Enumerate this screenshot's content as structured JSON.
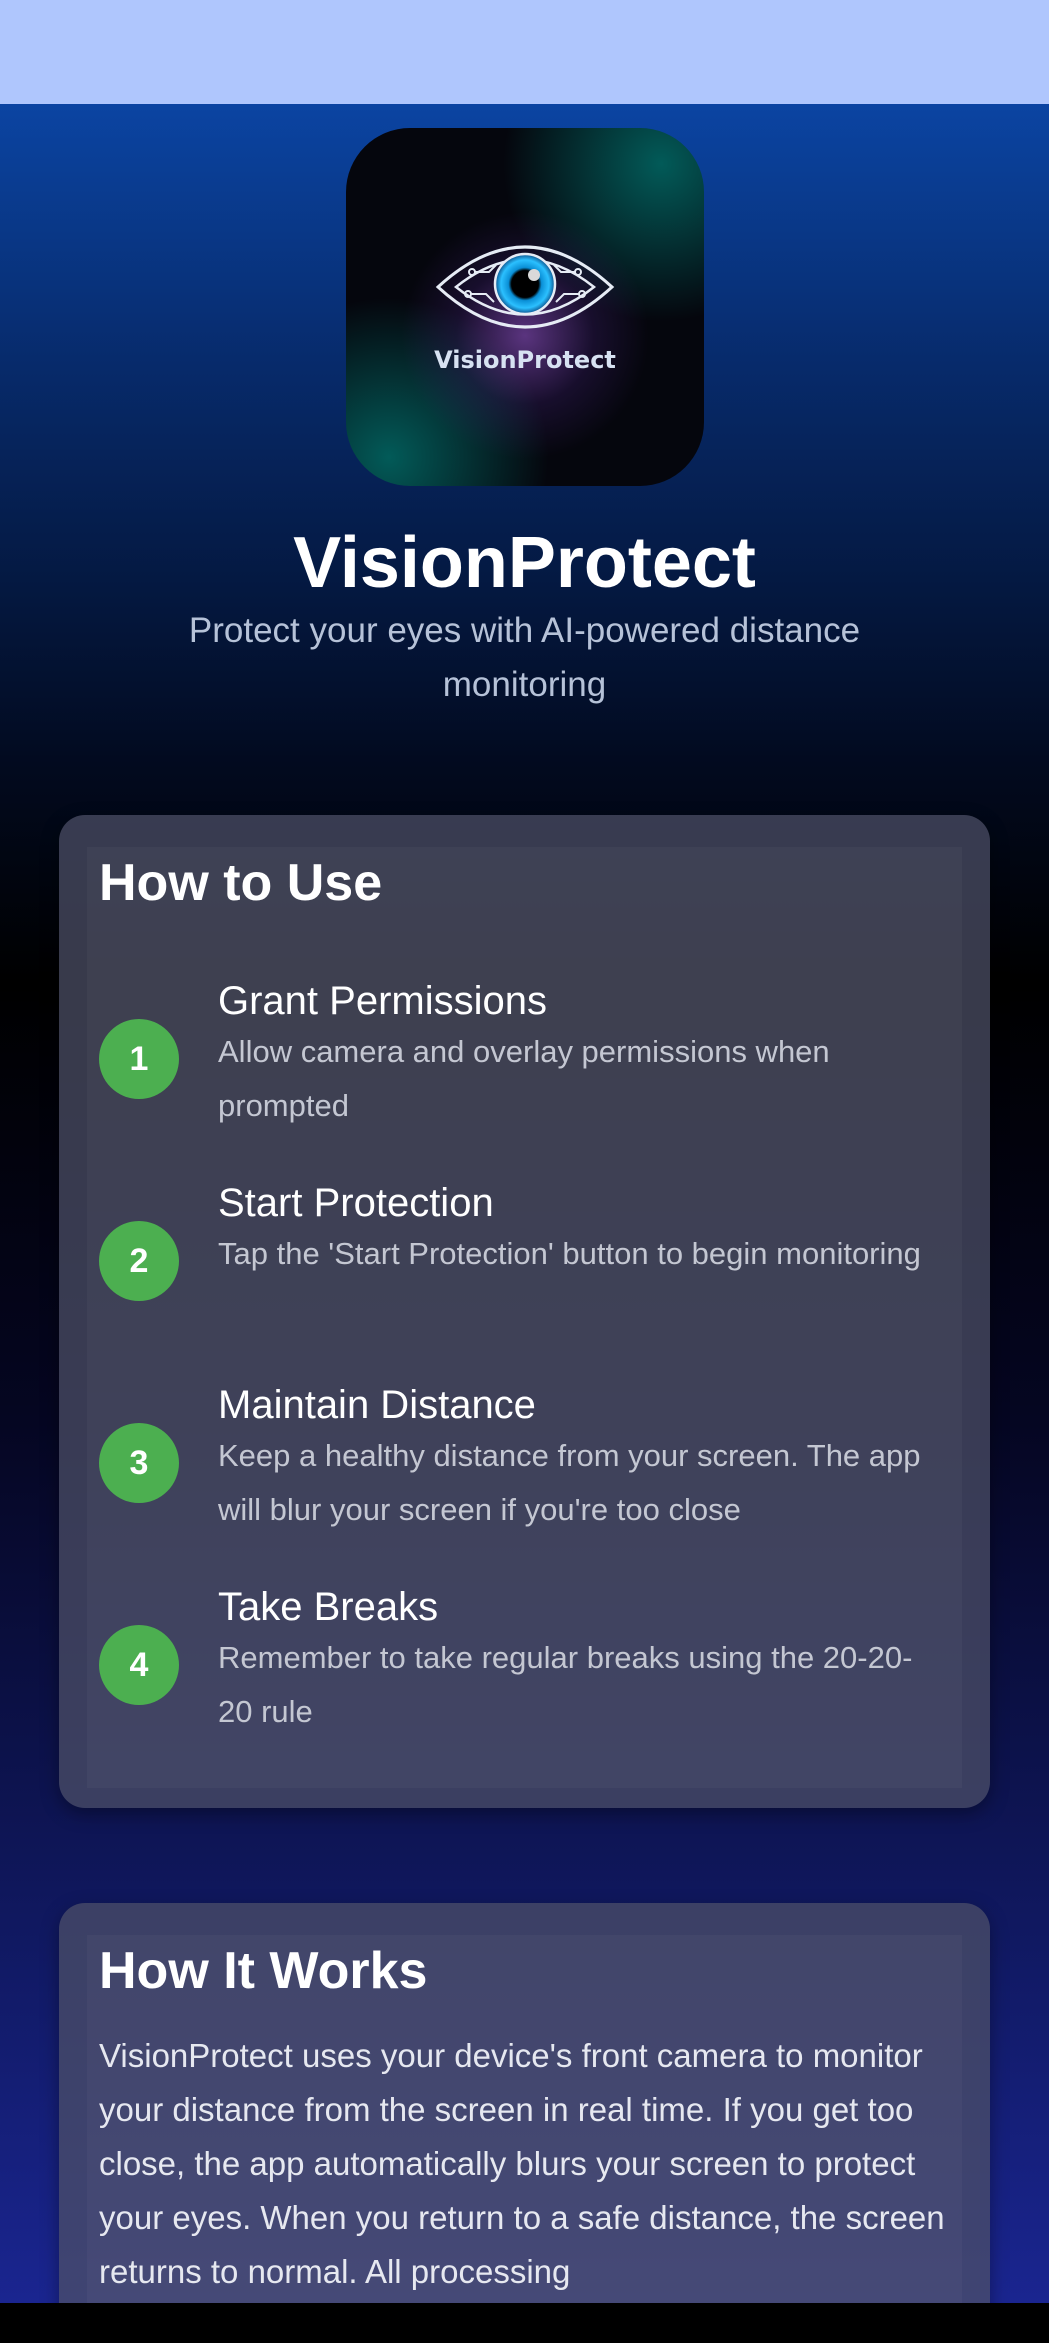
{
  "app": {
    "logo_text": "VisionProtect",
    "title": "VisionProtect",
    "subtitle": "Protect your eyes with AI-powered distance monitoring"
  },
  "how_to_use": {
    "title": "How to Use",
    "steps": [
      {
        "number": "1",
        "title": "Grant Permissions",
        "description": "Allow camera and overlay permissions when prompted"
      },
      {
        "number": "2",
        "title": "Start Protection",
        "description": "Tap the 'Start Protection' button to begin monitoring"
      },
      {
        "number": "3",
        "title": "Maintain Distance",
        "description": "Keep a healthy distance from your screen. The app will blur your screen if you're too close"
      },
      {
        "number": "4",
        "title": "Take Breaks",
        "description": "Remember to take regular breaks using the 20-20-20 rule"
      }
    ]
  },
  "how_it_works": {
    "title": "How It Works",
    "body": "VisionProtect uses your device's front camera to monitor your distance from the screen in real time. If you get too close, the app automatically blurs your screen to protect your eyes. When you return to a safe distance, the screen returns to normal. All processing"
  },
  "colors": {
    "status_bar": "#afc6fd",
    "step_badge": "#4caf50",
    "card_bg": "#4e5068"
  },
  "icons": {
    "logo": "eye-icon"
  }
}
